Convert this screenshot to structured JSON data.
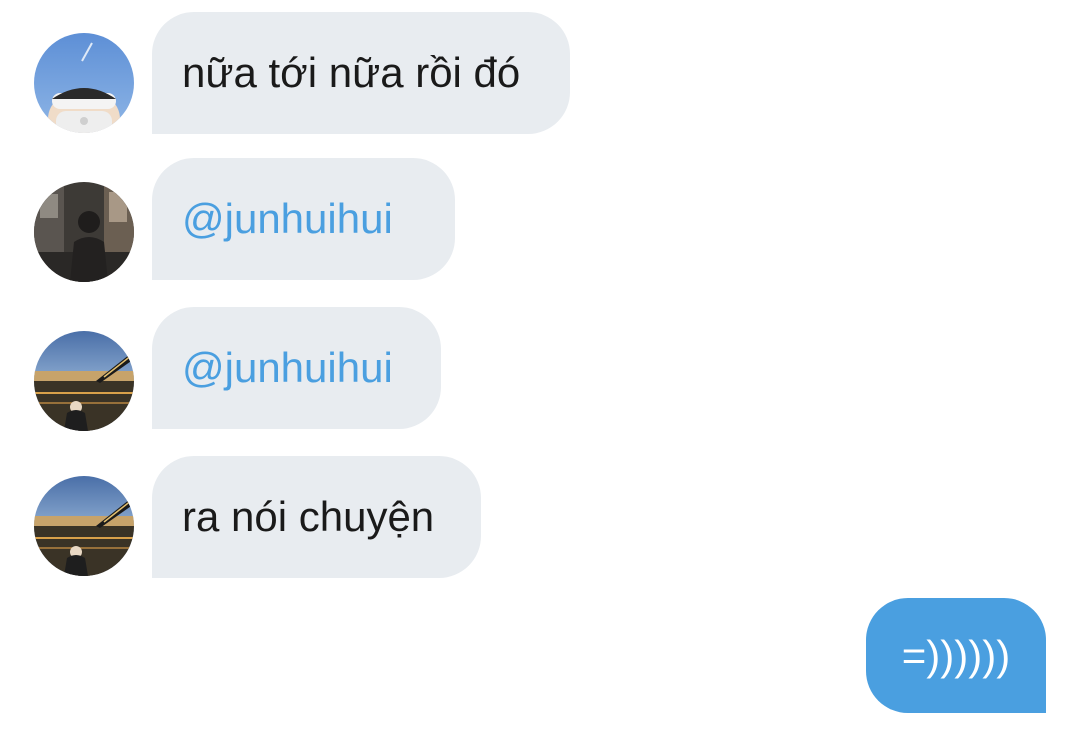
{
  "messages": [
    {
      "sender": "them",
      "avatar": "person-with-headband-avatar",
      "text": "nữa tới nữa rồi đó"
    },
    {
      "sender": "them",
      "avatar": "person-in-street-avatar",
      "text": "@junhuihui"
    },
    {
      "sender": "them",
      "avatar": "person-by-river-bridge-avatar",
      "text": "@junhuihui"
    },
    {
      "sender": "them",
      "avatar": "person-by-river-bridge-avatar",
      "text": "ra nói chuyện"
    },
    {
      "sender": "me",
      "text": "=))))))"
    }
  ],
  "colors": {
    "incoming_bubble": "#e8ecf0",
    "outgoing_bubble": "#4a9fe0",
    "mention_text": "#4a9fe0",
    "incoming_text": "#1a1a1a",
    "outgoing_text": "#ffffff"
  }
}
